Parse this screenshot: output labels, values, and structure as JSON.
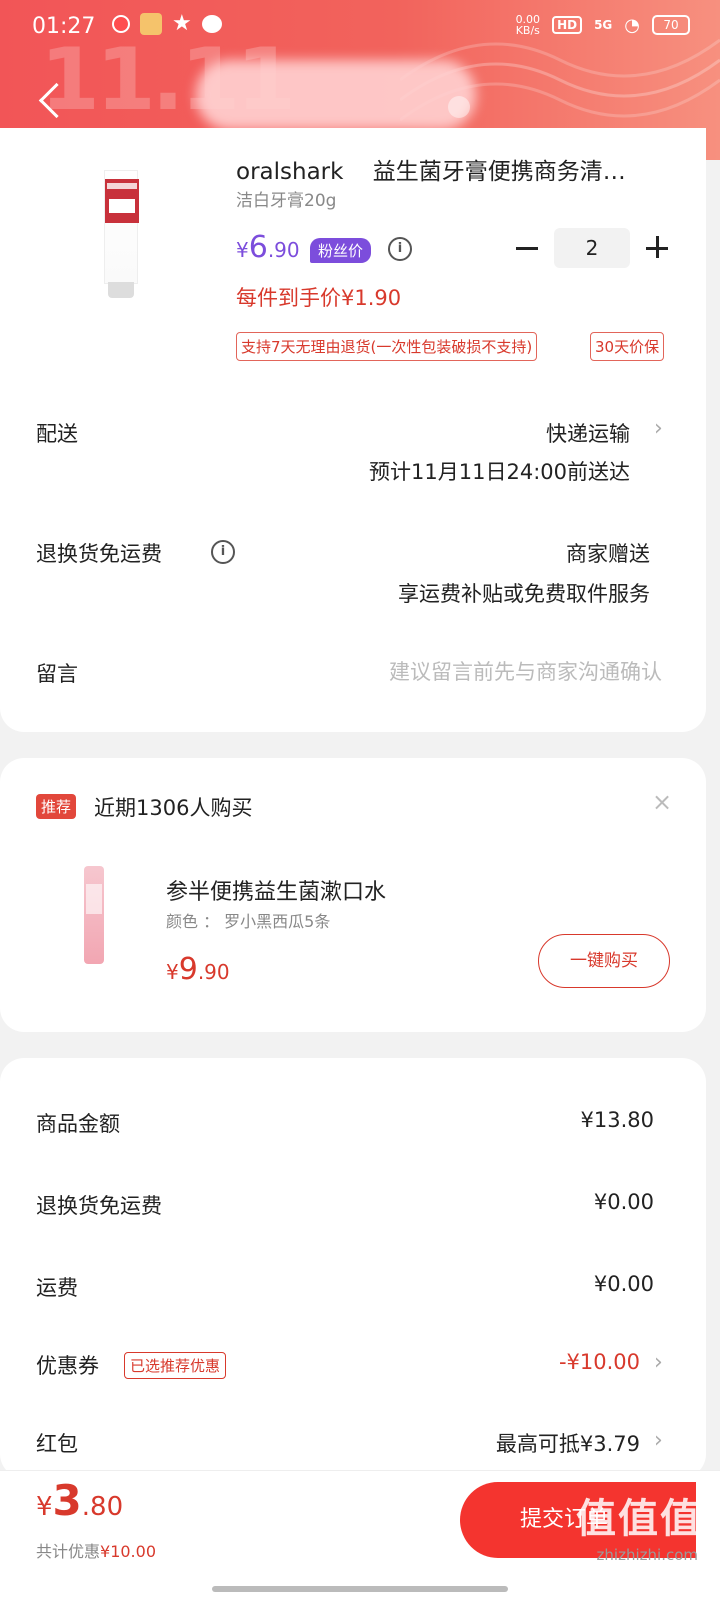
{
  "status_bar": {
    "time": "01:27",
    "net_speed": "0.00",
    "net_unit": "KB/s",
    "hd": "HD",
    "signal": "5G",
    "battery": "70"
  },
  "header": {
    "deco": "11.11"
  },
  "product": {
    "brand": "oralshark",
    "title": "益生菌牙膏便携商务清…",
    "spec": "洁白牙膏20g",
    "price_symbol": "¥",
    "price_int": "6",
    "price_dec": ".90",
    "fan_badge": "粉丝价",
    "quantity": "2",
    "per_price": "每件到手价¥1.90",
    "tags": [
      "支持7天无理由退货(一次性包装破损不支持)",
      "30天价保"
    ]
  },
  "delivery": {
    "label": "配送",
    "method": "快递运输",
    "eta": "预计11月11日24:00前送达"
  },
  "return_fee": {
    "label": "退换货免运费",
    "value": "商家赠送",
    "desc": "享运费补贴或免费取件服务"
  },
  "message": {
    "label": "留言",
    "placeholder": "建议留言前先与商家沟通确认"
  },
  "recommend": {
    "badge": "推荐",
    "title": "近期1306人购买",
    "close": "×",
    "name": "参半便携益生菌漱口水",
    "spec": "颜色 ： 罗小黑西瓜5条",
    "price_symbol": "¥",
    "price_int": "9",
    "price_dec": ".90",
    "buy_label": "一键购买"
  },
  "summary": {
    "goods_label": "商品金额",
    "goods_value": "¥13.80",
    "return_label": "退换货免运费",
    "return_value": "¥0.00",
    "shipping_label": "运费",
    "shipping_value": "¥0.00",
    "coupon_label": "优惠券",
    "coupon_tag": "已选推荐优惠",
    "coupon_value": "-¥10.00",
    "redpack_label": "红包",
    "redpack_value": "最高可抵¥3.79"
  },
  "footer": {
    "total_symbol": "¥",
    "total_int": "3",
    "total_dec": ".80",
    "discount_prefix": "共计优惠",
    "discount_value": "¥10.00",
    "submit_label": "提交订单",
    "watermark": "值值值",
    "watermark_url": "zhizhizhi.com"
  }
}
